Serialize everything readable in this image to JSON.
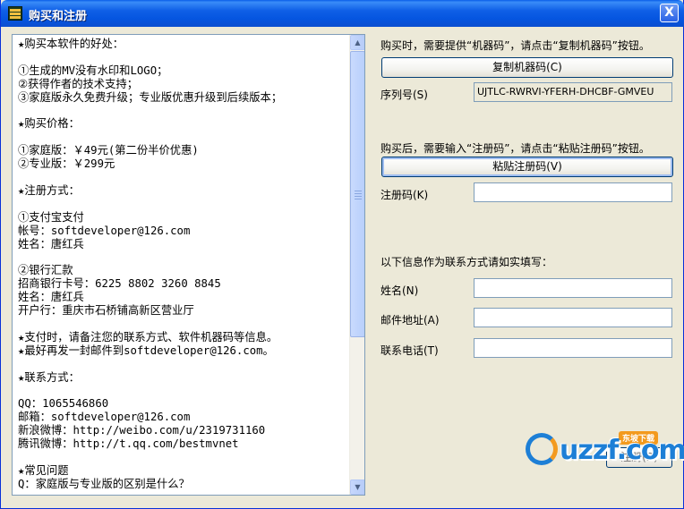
{
  "window": {
    "title": "购买和注册",
    "close_label": "X"
  },
  "memo": {
    "text": "★购买本软件的好处：\n\n①生成的MV没有水印和LOGO；\n②获得作者的技术支持；\n③家庭版永久免费升级；专业版优惠升级到后续版本；\n\n★购买价格：\n\n①家庭版：￥49元(第二份半价优惠)\n②专业版：￥299元\n\n★注册方式：\n\n①支付宝支付\n帐号：softdeveloper@126.com\n姓名：唐红兵\n\n②银行汇款\n招商银行卡号：6225 8802 3260 8845\n姓名：唐红兵\n开户行：重庆市石桥铺高新区营业厅\n\n★支付时，请备注您的联系方式、软件机器码等信息。\n★最好再发一封邮件到softdeveloper@126.com。\n\n★联系方式：\n\nQQ：1065546860\n邮箱：softdeveloper@126.com\n新浪微博：http://weibo.com/u/2319731160\n腾讯微博：http://t.qq.com/bestmvnet\n\n★常见问题\nQ：家庭版与专业版的区别是什么？"
  },
  "machine": {
    "instruction": "购买时，需要提供“机器码”，请点击“复制机器码”按钮。",
    "copy_button": "复制机器码(C)",
    "serial_label": "序列号(S)",
    "serial_value": "UJTLC-RWRVI-YFERH-DHCBF-GMVEU"
  },
  "registration": {
    "instruction": "购买后，需要输入“注册码”，请点击“粘贴注册码”按钮。",
    "paste_button": "粘贴注册码(V)",
    "code_label": "注册码(K)",
    "code_value": ""
  },
  "contact": {
    "instruction": "以下信息作为联系方式请如实填写：",
    "name_label": "姓名(N)",
    "name_value": "",
    "email_label": "邮件地址(A)",
    "email_value": "",
    "phone_label": "联系电话(T)",
    "phone_value": ""
  },
  "actions": {
    "register_button": "注册(R)"
  },
  "watermark": {
    "text": "uzzf.com",
    "badge": "东坡下载"
  }
}
